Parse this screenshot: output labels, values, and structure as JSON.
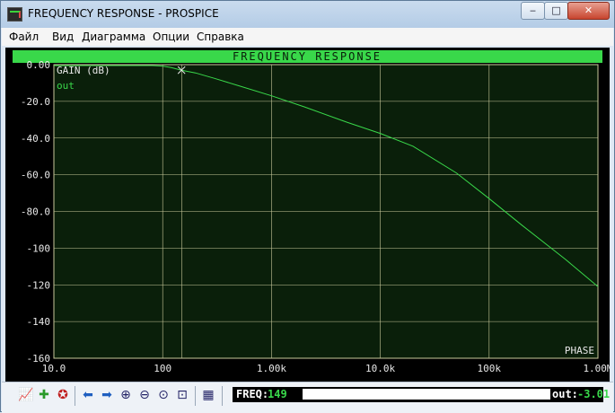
{
  "window": {
    "title": "FREQUENCY RESPONSE - PROSPICE",
    "controls": {
      "minimize": "‒",
      "maximize": "□",
      "close": "✕"
    }
  },
  "menu": {
    "items": [
      "Файл",
      "Вид",
      "Диаграмма",
      "Опции",
      "Справка"
    ]
  },
  "chart_data": {
    "type": "line",
    "title": "FREQUENCY RESPONSE",
    "ylabel": "GAIN (dB)",
    "y2label": "PHASE",
    "xscale": "log",
    "xlim": [
      10,
      1000000
    ],
    "ylim": [
      -160,
      0
    ],
    "xticks": [
      10,
      100,
      1000,
      10000,
      100000,
      1000000
    ],
    "xticklabels": [
      "10.0",
      "100",
      "1.00k",
      "10.0k",
      "100k",
      "1.00M"
    ],
    "yticks": [
      0,
      -20,
      -40,
      -60,
      -80,
      -100,
      -120,
      -140,
      -160
    ],
    "yticklabels": [
      "0.00",
      "-20.0",
      "-40.0",
      "-60.0",
      "-80.0",
      "-100",
      "-120",
      "-140",
      "-160"
    ],
    "minor_xticks": [
      150
    ],
    "grid": true,
    "series": [
      {
        "name": "out",
        "color": "#39d84a",
        "x": [
          10,
          30,
          60,
          80,
          100,
          120,
          149,
          200,
          300,
          500,
          1000,
          2000,
          5000,
          10000,
          20000,
          50000,
          100000,
          200000,
          500000,
          1000000
        ],
        "y": [
          0,
          0,
          -0.1,
          -0.3,
          -0.8,
          -1.6,
          -3.01,
          -4.5,
          -7.5,
          -11.5,
          -17.0,
          -23.0,
          -31.5,
          -37.5,
          -44.5,
          -59.0,
          -73.0,
          -87.5,
          -106.0,
          -121.0
        ]
      }
    ],
    "cursor": {
      "x": 149,
      "y": -3.01
    },
    "colors": {
      "background": "#0a1f0a",
      "frame": "#000000",
      "grid": "#c9c99b",
      "header": "#39d84a",
      "labels": "#e8e8e8",
      "trace": "#39d84a"
    }
  },
  "toolbar": {
    "icons": [
      "graph-icon",
      "add-trace-icon",
      "run-icon",
      "arrow-left-icon",
      "arrow-right-icon",
      "zoom-in-icon",
      "zoom-out-icon",
      "zoom-all-icon",
      "zoom-area-icon",
      "export-graph-icon"
    ],
    "cursor": {
      "freq_label": "FREQ:",
      "freq_value": "149",
      "out_label": "out:",
      "out_value": "-3.01"
    }
  }
}
